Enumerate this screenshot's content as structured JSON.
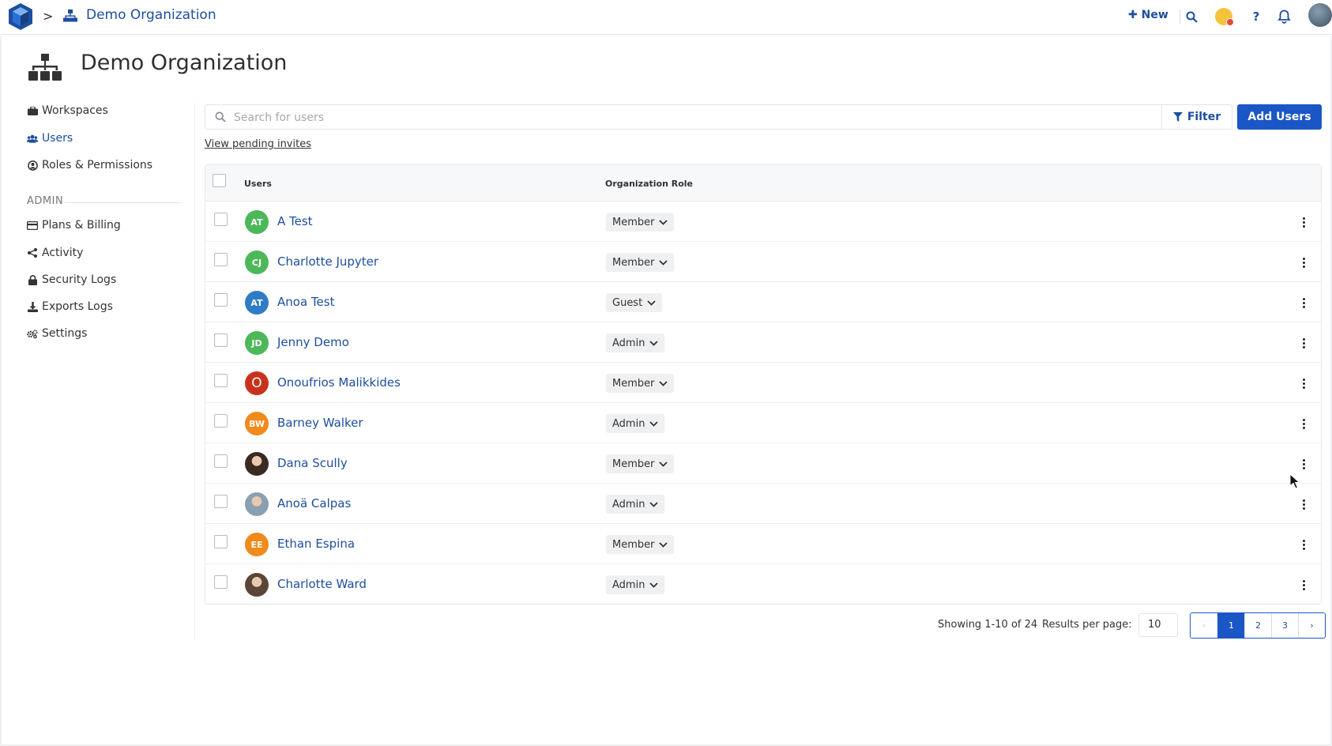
{
  "topbar": {
    "breadcrumb_sep": ">",
    "org_name": "Demo Organization",
    "new_label": "New",
    "help_glyph": "?"
  },
  "page": {
    "title": "Demo Organization"
  },
  "sidebar": {
    "items": [
      {
        "label": "Workspaces",
        "icon": "briefcase-icon",
        "active": false
      },
      {
        "label": "Users",
        "icon": "users-icon",
        "active": true
      },
      {
        "label": "Roles & Permissions",
        "icon": "user-circle-icon",
        "active": false
      }
    ],
    "admin_label": "ADMIN",
    "admin_items": [
      {
        "label": "Plans & Billing",
        "icon": "credit-card-icon"
      },
      {
        "label": "Activity",
        "icon": "share-icon"
      },
      {
        "label": "Security Logs",
        "icon": "lock-icon"
      },
      {
        "label": "Exports Logs",
        "icon": "download-icon"
      },
      {
        "label": "Settings",
        "icon": "gears-icon"
      }
    ]
  },
  "search": {
    "placeholder": "Search for users",
    "value": ""
  },
  "toolbar": {
    "filter_label": "Filter",
    "add_users_label": "Add Users",
    "pending_label": "View pending invites"
  },
  "table": {
    "columns": [
      "Users",
      "Organization Role"
    ],
    "rows": [
      {
        "initials": "AT",
        "name": "A Test",
        "role": "Member",
        "avatar_color": "#4cb85a",
        "avatar_type": "initials"
      },
      {
        "initials": "CJ",
        "name": "Charlotte Jupyter",
        "role": "Member",
        "avatar_color": "#4cb85a",
        "avatar_type": "initials"
      },
      {
        "initials": "AT",
        "name": "Anoa Test",
        "role": "Guest",
        "avatar_color": "#2f7cc6",
        "avatar_type": "initials"
      },
      {
        "initials": "JD",
        "name": "Jenny Demo",
        "role": "Admin",
        "avatar_color": "#4cb85a",
        "avatar_type": "initials"
      },
      {
        "initials": "O",
        "name": "Onoufrios Malikkides",
        "role": "Member",
        "avatar_color": "#c8321c",
        "avatar_type": "initials-large"
      },
      {
        "initials": "BW",
        "name": "Barney Walker",
        "role": "Admin",
        "avatar_color": "#f08a1c",
        "avatar_type": "initials"
      },
      {
        "initials": "",
        "name": "Dana Scully",
        "role": "Member",
        "avatar_color": "#3a2a22",
        "avatar_type": "photo"
      },
      {
        "initials": "",
        "name": "Anoä Calpas",
        "role": "Admin",
        "avatar_color": "#8aa0b2",
        "avatar_type": "photo"
      },
      {
        "initials": "EE",
        "name": "Ethan Espina",
        "role": "Member",
        "avatar_color": "#f08a1c",
        "avatar_type": "initials"
      },
      {
        "initials": "",
        "name": "Charlotte Ward",
        "role": "Admin",
        "avatar_color": "#5a4638",
        "avatar_type": "photo"
      }
    ]
  },
  "pagination": {
    "showing": "Showing 1-10 of 24",
    "rpp_label": "Results per page:",
    "rpp_value": "10",
    "prev": "‹",
    "pages": [
      "1",
      "2",
      "3"
    ],
    "current_page": "1",
    "next": "›"
  },
  "colors": {
    "accent": "#1a56c6",
    "link": "#1d4e9e"
  }
}
